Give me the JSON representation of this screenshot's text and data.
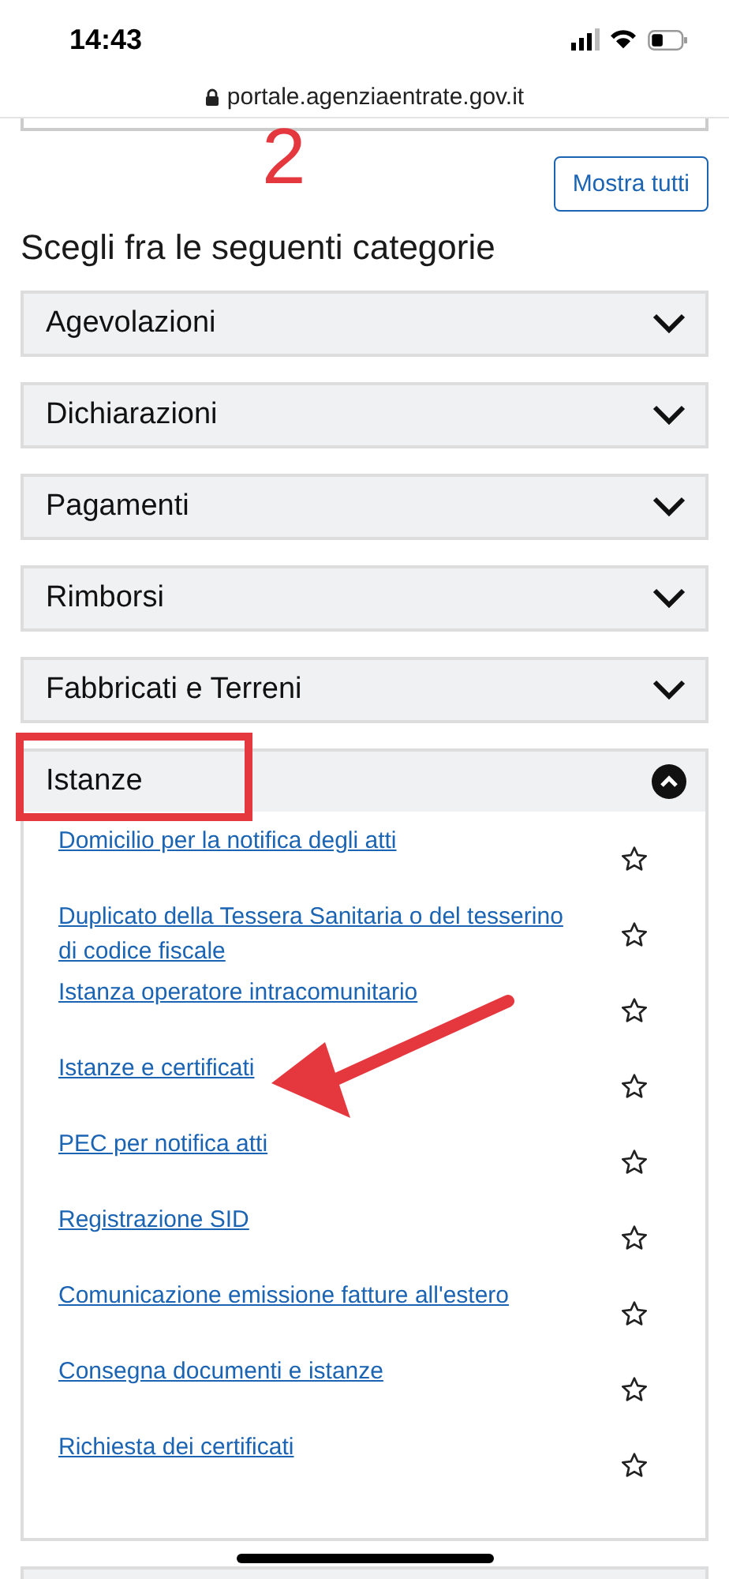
{
  "status_bar": {
    "time": "14:43"
  },
  "address_bar": {
    "url": "portale.agenziaentrate.gov.it"
  },
  "annotations": [
    {
      "kind": "number",
      "text": "2"
    },
    {
      "kind": "frame"
    },
    {
      "kind": "arrow"
    }
  ],
  "show_all_button": "Mostra tutti",
  "heading": "Scegli fra le seguenti categorie",
  "categories": [
    {
      "label": "Agevolazioni",
      "expanded": false
    },
    {
      "label": "Dichiarazioni",
      "expanded": false
    },
    {
      "label": "Pagamenti",
      "expanded": false
    },
    {
      "label": "Rimborsi",
      "expanded": false
    },
    {
      "label": "Fabbricati e Terreni",
      "expanded": false
    },
    {
      "label": "Istanze",
      "expanded": true,
      "items": [
        {
          "label": "Domicilio per la notifica degli atti",
          "favorite": false
        },
        {
          "label": "Duplicato della Tessera Sanitaria o del tesserino di codice fiscale",
          "favorite": false
        },
        {
          "label": "Istanza operatore intracomunitario",
          "favorite": false
        },
        {
          "label": "Istanze e certificati",
          "favorite": false
        },
        {
          "label": "PEC per notifica atti",
          "favorite": false
        },
        {
          "label": "Registrazione SID",
          "favorite": false
        },
        {
          "label": "Comunicazione emissione fatture all'estero",
          "favorite": false
        },
        {
          "label": "Consegna documenti e istanze",
          "favorite": false
        },
        {
          "label": "Richiesta dei certificati",
          "favorite": false
        }
      ]
    }
  ]
}
